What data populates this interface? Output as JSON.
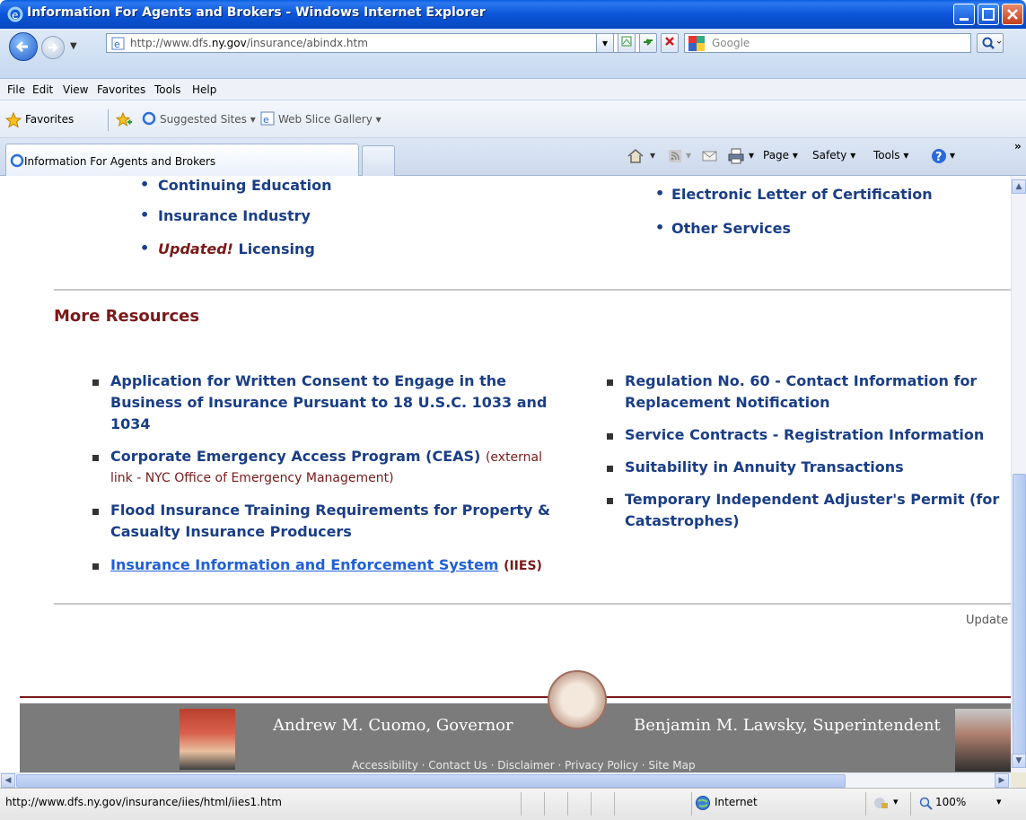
{
  "window": {
    "title": "Information For Agents and Brokers - Windows Internet Explorer"
  },
  "address": {
    "prefix": "http://www.dfs.",
    "host": "ny.gov",
    "suffix": "/insurance/abindx.htm"
  },
  "search": {
    "placeholder": "Google"
  },
  "menu": [
    "File",
    "Edit",
    "View",
    "Favorites",
    "Tools",
    "Help"
  ],
  "favorites_bar": {
    "favorites": "Favorites",
    "suggested": "Suggested Sites ▾",
    "webslice": "Web Slice Gallery ▾"
  },
  "tab": {
    "label": "Information For Agents and Brokers"
  },
  "command_bar": {
    "page": "Page ▾",
    "safety": "Safety ▾",
    "tools": "Tools ▾"
  },
  "top_links_left": [
    "Continuing Education",
    "Insurance Industry"
  ],
  "top_links_left_updated": {
    "flag": "Updated!",
    "label": "Licensing"
  },
  "top_links_right": [
    "Electronic Letter of Certification",
    "Other Services"
  ],
  "more_resources": {
    "title": "More Resources",
    "left": [
      {
        "line1": "Application for Written Consent to Engage in the",
        "line2": "Business of Insurance Pursuant to 18 U.S.C. 1033 and",
        "line3": "1034"
      },
      {
        "line1": "Corporate Emergency Access Program (CEAS)",
        "note1": "(external",
        "note2": "link - NYC Office of Emergency Management)"
      },
      {
        "line1": "Flood Insurance Training Requirements for Property &",
        "line2": "Casualty Insurance Producers"
      },
      {
        "link": "Insurance Information and Enforcement System",
        "note": "(IIES)"
      }
    ],
    "right": [
      {
        "line1": "Regulation No. 60 - Contact Information for",
        "line2": "Replacement Notification"
      },
      {
        "line1": "Service Contracts - Registration Information"
      },
      {
        "line1": "Suitability in Annuity Transactions"
      },
      {
        "line1": "Temporary Independent Adjuster's Permit (for",
        "line2": "Catastrophes)"
      }
    ]
  },
  "updated_fragment": "Update",
  "footer": {
    "governor": "Andrew M. Cuomo, Governor",
    "superintendent": "Benjamin M. Lawsky, Superintendent",
    "links_partial": "Accessibility · Contact Us · Disclaimer · Privacy Policy · Site Map"
  },
  "status": {
    "url": "http://www.dfs.ny.gov/insurance/iies/html/iies1.htm",
    "zone": "Internet",
    "zoom": "100%"
  },
  "colors": {
    "link": "#1a3e86",
    "maroon": "#7a1a1a",
    "titlebar": "#0a55d8"
  }
}
